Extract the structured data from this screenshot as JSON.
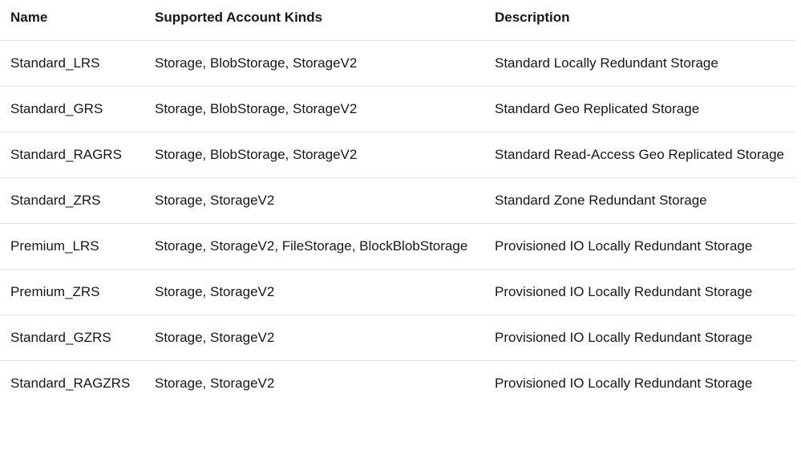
{
  "table": {
    "headers": {
      "name": "Name",
      "kinds": "Supported Account Kinds",
      "description": "Description"
    },
    "rows": [
      {
        "name": "Standard_LRS",
        "kinds": "Storage, BlobStorage, StorageV2",
        "description": "Standard Locally Redundant Storage"
      },
      {
        "name": "Standard_GRS",
        "kinds": "Storage, BlobStorage, StorageV2",
        "description": "Standard Geo Replicated Storage"
      },
      {
        "name": "Standard_RAGRS",
        "kinds": "Storage, BlobStorage, StorageV2",
        "description": "Standard Read-Access Geo Replicated Storage"
      },
      {
        "name": "Standard_ZRS",
        "kinds": "Storage, StorageV2",
        "description": "Standard Zone Redundant Storage"
      },
      {
        "name": "Premium_LRS",
        "kinds": "Storage, StorageV2, FileStorage, BlockBlobStorage",
        "description": "Provisioned IO Locally Redundant Storage"
      },
      {
        "name": "Premium_ZRS",
        "kinds": "Storage, StorageV2",
        "description": "Provisioned IO Locally Redundant Storage"
      },
      {
        "name": "Standard_GZRS",
        "kinds": "Storage, StorageV2",
        "description": "Provisioned IO Locally Redundant Storage"
      },
      {
        "name": "Standard_RAGZRS",
        "kinds": "Storage, StorageV2",
        "description": "Provisioned IO Locally Redundant Storage"
      }
    ]
  }
}
